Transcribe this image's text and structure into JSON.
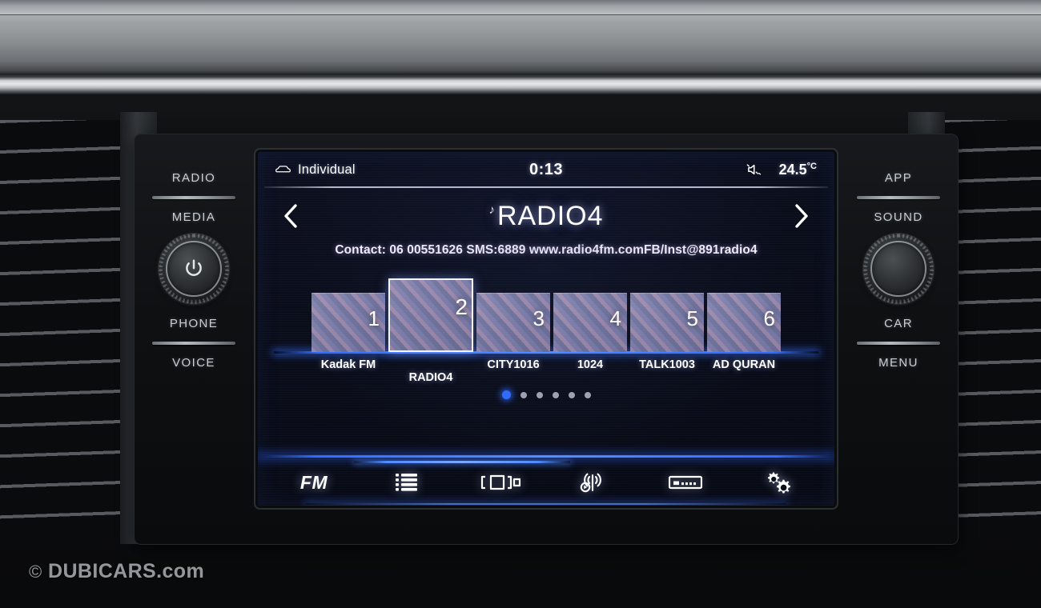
{
  "watermark": {
    "symbol": "©",
    "text": "DUBICARS.com"
  },
  "hardware": {
    "left": {
      "top_label": "RADIO",
      "mid_label": "MEDIA",
      "lower_label": "PHONE",
      "bottom_label": "VOICE",
      "knob_icon": "power-icon"
    },
    "right": {
      "top_label": "APP",
      "mid_label": "SOUND",
      "lower_label": "CAR",
      "bottom_label": "MENU",
      "knob_icon": "volume-knob-icon"
    }
  },
  "screen": {
    "statusbar": {
      "profile_icon": "car-profile-icon",
      "profile": "Individual",
      "clock": "0:13",
      "mute_icon": "speaker-mute-icon",
      "temperature": "24.5",
      "temperature_unit": "°C"
    },
    "header": {
      "prev_icon": "chevron-left-icon",
      "next_icon": "chevron-right-icon",
      "note_icon": "music-note-icon",
      "station": "RADIO4",
      "radiotext": "Contact: 06 00551626 SMS:6889 www.radio4fm.comFB/Inst@891radio4"
    },
    "presets": [
      {
        "number": "1",
        "name": "Kadak FM",
        "active": false
      },
      {
        "number": "2",
        "name": "RADIO4",
        "active": true
      },
      {
        "number": "3",
        "name": "CITY1016",
        "active": false
      },
      {
        "number": "4",
        "name": "1024",
        "active": false
      },
      {
        "number": "5",
        "name": "TALK1003",
        "active": false
      },
      {
        "number": "6",
        "name": "AD QURAN",
        "active": false
      }
    ],
    "pagination": {
      "total": 6,
      "active_index": 0
    },
    "toolbar": [
      {
        "id": "band",
        "label": "FM",
        "icon": "fm-band-label",
        "type": "text"
      },
      {
        "id": "list",
        "label": "",
        "icon": "station-list-icon",
        "type": "icon"
      },
      {
        "id": "presets",
        "label": "",
        "icon": "preset-scan-icon",
        "type": "icon"
      },
      {
        "id": "traffic",
        "label": "",
        "icon": "radio-broadcast-icon",
        "type": "icon"
      },
      {
        "id": "manual",
        "label": "",
        "icon": "frequency-band-icon",
        "type": "icon"
      },
      {
        "id": "settings",
        "label": "",
        "icon": "gears-settings-icon",
        "type": "icon"
      }
    ],
    "colors": {
      "accent_blue": "#2f6bff",
      "screen_bg": "#0a0d1a",
      "text": "#eef0f7"
    }
  }
}
